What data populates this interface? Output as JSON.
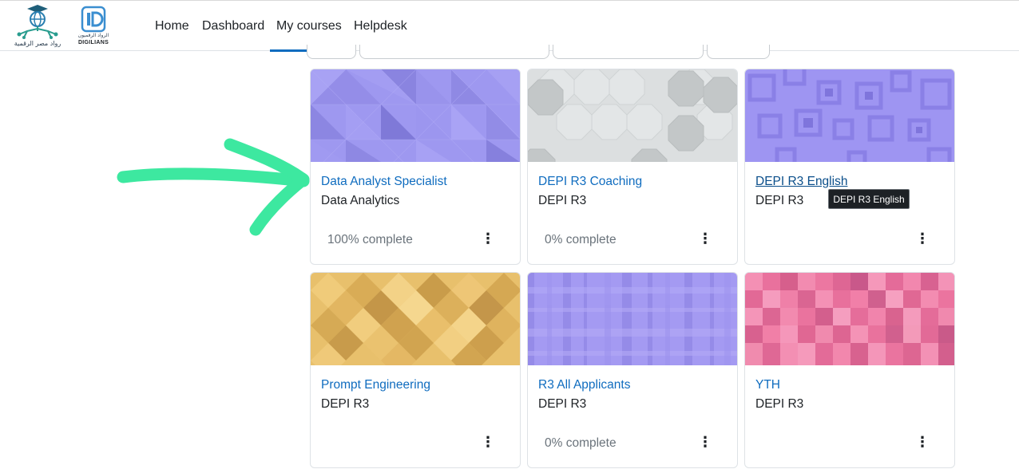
{
  "brand": {
    "logo_left_text": "رواد مصر الرقمية",
    "logo_right_arabic": "الرواد الرقميون",
    "logo_right_english": "DIGILIANS"
  },
  "nav": {
    "items": [
      "Home",
      "Dashboard",
      "My courses",
      "Helpdesk"
    ],
    "active": "My courses"
  },
  "colors": {
    "link": "#0f6cbf",
    "active_underline": "#0f6cbf",
    "annotation_arrow": "#3de8a0",
    "tooltip_bg": "#1d2125"
  },
  "courses": [
    {
      "title": "Data Analyst Specialist",
      "category": "Data Analytics",
      "progress": "100% complete",
      "menu_icon": "kebab-icon",
      "pattern": "triangles-purple"
    },
    {
      "title": "DEPI R3 Coaching",
      "category": "DEPI R3",
      "progress": "0% complete",
      "menu_icon": "kebab-icon",
      "pattern": "octagons-grey"
    },
    {
      "title": "DEPI R3 English",
      "category": "DEPI R3",
      "progress": "",
      "menu_icon": "kebab-icon",
      "pattern": "squares-purple"
    },
    {
      "title": "Prompt Engineering",
      "category": "DEPI R3",
      "progress": "",
      "menu_icon": "kebab-icon",
      "pattern": "diamonds-gold"
    },
    {
      "title": "R3 All Applicants",
      "category": "DEPI R3",
      "progress": "0% complete",
      "menu_icon": "kebab-icon",
      "pattern": "plaid-purple"
    },
    {
      "title": "YTH",
      "category": "DEPI R3",
      "progress": "",
      "menu_icon": "kebab-icon",
      "pattern": "mosaic-pink"
    }
  ],
  "tooltip": {
    "text": "DEPI R3 English"
  },
  "annotation": {
    "type": "hand-drawn-arrow",
    "points_to": "Data Analyst Specialist"
  }
}
